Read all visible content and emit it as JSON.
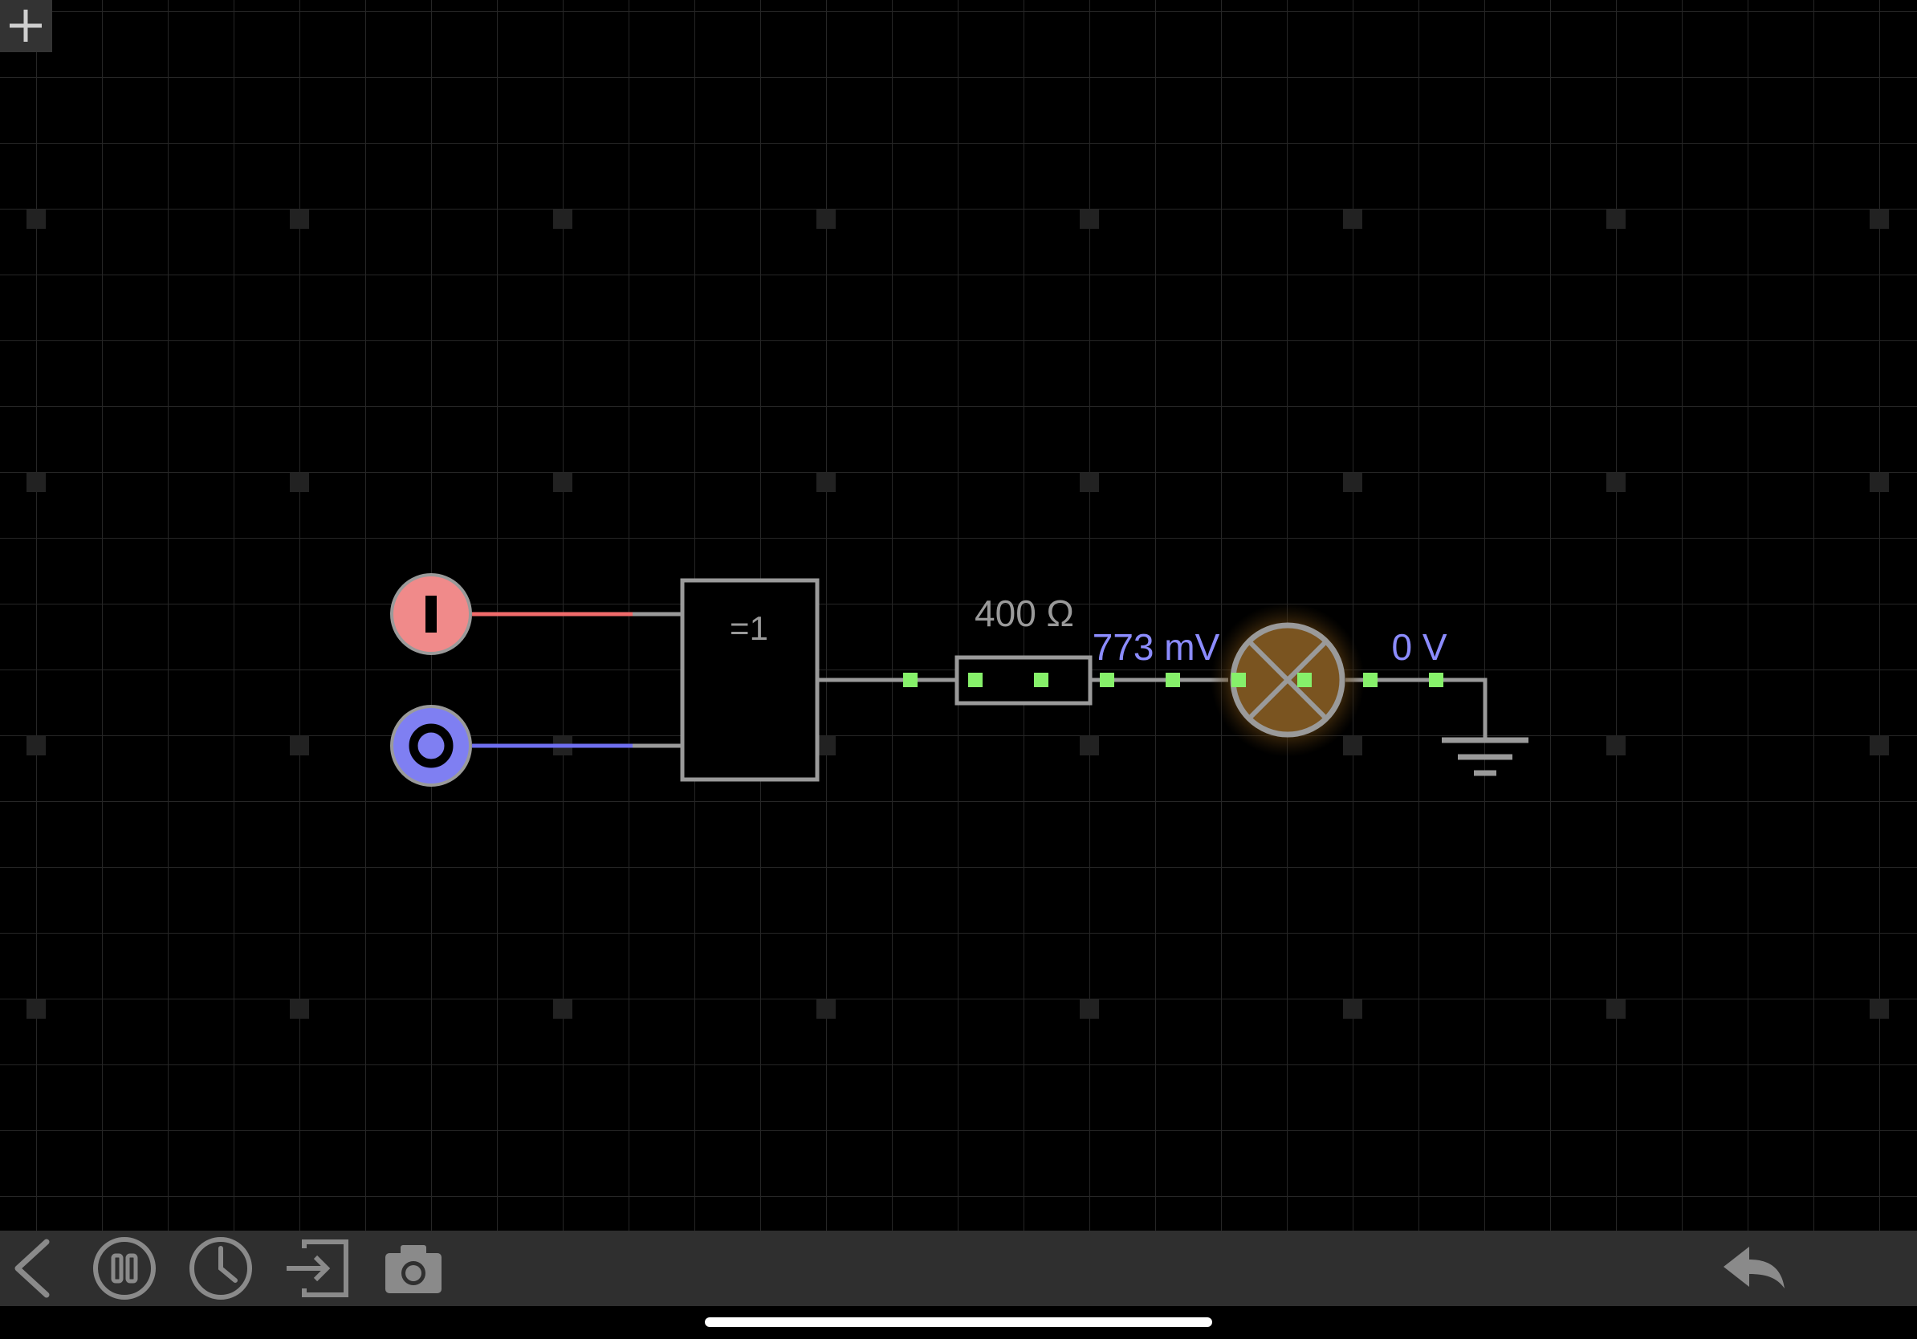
{
  "app": {
    "add_button_icon": "plus-icon"
  },
  "circuit": {
    "input_a": {
      "state": "I",
      "color": "#f08a8a",
      "wire_color": "#f06b6b"
    },
    "input_b": {
      "state": "O",
      "color": "#7f7ff2",
      "wire_color": "#6f6ff0"
    },
    "gate": {
      "label": "=1"
    },
    "resistor": {
      "label": "400 Ω"
    },
    "probe_1": {
      "label": "773 mV",
      "color": "#8c8cff"
    },
    "probe_2": {
      "label": "0 V",
      "color": "#8c8cff"
    },
    "lamp": {
      "glow_color": "#8a5a1a"
    },
    "node_color": "#86f06a",
    "wire_color": "#9a9a9a"
  },
  "toolbar": {
    "back_icon": "chevron-left-icon",
    "pause_icon": "pause-icon",
    "clock_icon": "clock-icon",
    "export_icon": "export-icon",
    "camera_icon": "camera-icon",
    "undo_icon": "undo-icon"
  }
}
